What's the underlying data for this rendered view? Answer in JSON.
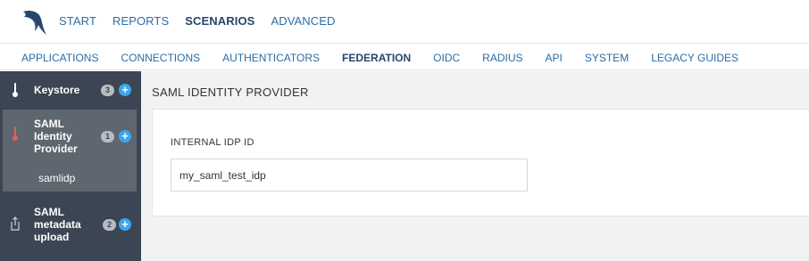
{
  "top_nav": {
    "items": [
      "START",
      "REPORTS",
      "SCENARIOS",
      "ADVANCED"
    ],
    "active": "SCENARIOS"
  },
  "sub_nav": {
    "items": [
      "APPLICATIONS",
      "CONNECTIONS",
      "AUTHENTICATORS",
      "FEDERATION",
      "OIDC",
      "RADIUS",
      "API",
      "SYSTEM",
      "LEGACY GUIDES"
    ],
    "active": "FEDERATION"
  },
  "sidebar": {
    "items": [
      {
        "label": "Keystore",
        "count": "3",
        "icon": "thermometer-icon"
      },
      {
        "label": "SAML Identity Provider",
        "count": "1",
        "icon": "thermometer-icon",
        "active": true,
        "children": [
          "samlidp"
        ]
      },
      {
        "label": "SAML metadata upload",
        "count": "2",
        "icon": "upload-icon"
      }
    ]
  },
  "main": {
    "title": "SAML IDENTITY PROVIDER",
    "field": {
      "label": "INTERNAL IDP ID",
      "value": "my_saml_test_idp"
    }
  },
  "colors": {
    "sidebar_bg": "#3c4553",
    "sidebar_active_bg": "#5e6670",
    "link": "#2a6da7",
    "active_link": "#27466b",
    "plus": "#3ba6ee",
    "accent_red": "#e0605a"
  }
}
